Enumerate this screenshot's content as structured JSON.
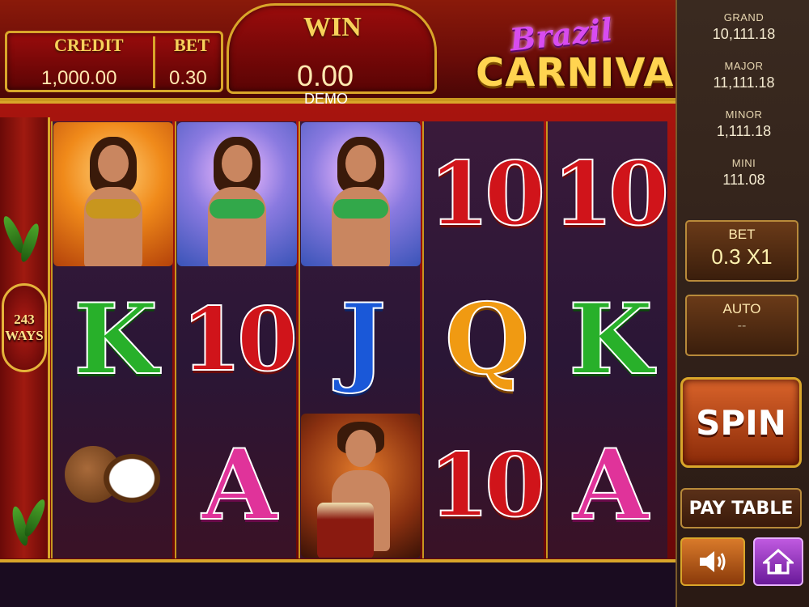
{
  "header": {
    "credit_label": "CREDIT",
    "credit_value": "1,000.00",
    "bet_label": "BET",
    "bet_value": "0.30",
    "win_label": "WIN",
    "win_value": "0.00",
    "demo_label": "DEMO"
  },
  "logo": {
    "line1": "Brazil",
    "line2": "CARNIVAL"
  },
  "ways": {
    "count": "243",
    "label": "WAYS"
  },
  "jackpots": [
    {
      "label": "GRAND",
      "value": "10,111.18"
    },
    {
      "label": "MAJOR",
      "value": "11,111.18"
    },
    {
      "label": "MINOR",
      "value": "1,111.18"
    },
    {
      "label": "MINI",
      "value": "111.08"
    }
  ],
  "controls": {
    "bet_label": "BET",
    "bet_value": "0.3 X1",
    "auto_label": "AUTO",
    "auto_value": "--",
    "spin_label": "SPIN",
    "paytable_label": "PAY TABLE"
  },
  "reels": [
    [
      "dancer-orange",
      "K",
      "coconut"
    ],
    [
      "dancer-blue",
      "10",
      "A"
    ],
    [
      "dancer-blue",
      "J",
      "drummer"
    ],
    [
      "10",
      "Q",
      "10"
    ],
    [
      "10",
      "K",
      "A"
    ]
  ],
  "icons": {
    "sound": "speaker-icon",
    "home": "home-icon"
  }
}
